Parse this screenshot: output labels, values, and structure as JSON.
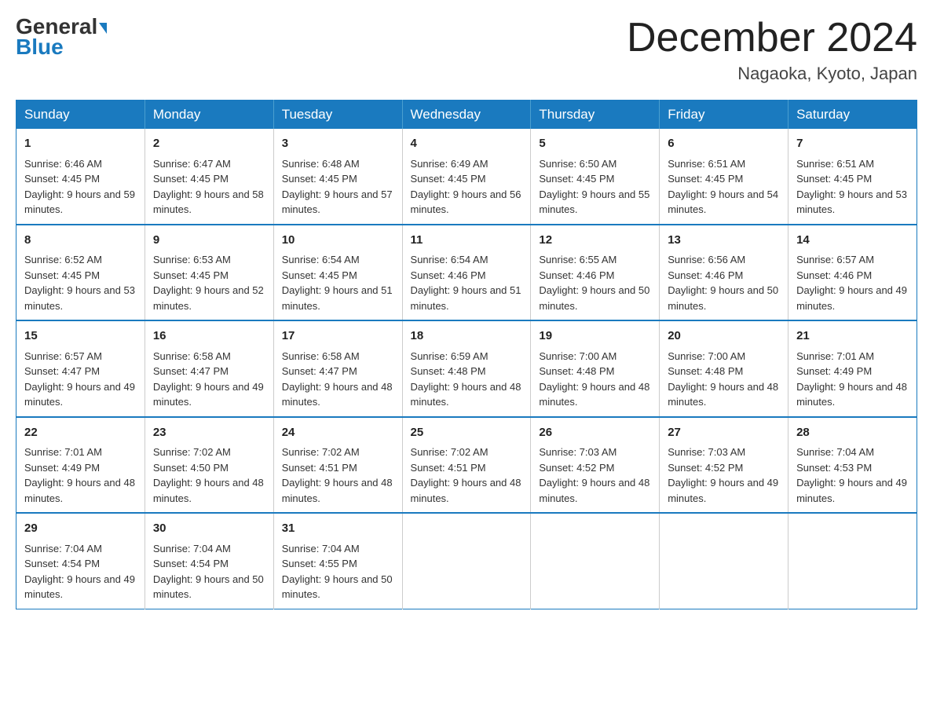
{
  "logo": {
    "part1": "General",
    "part2": "Blue"
  },
  "header": {
    "month": "December 2024",
    "location": "Nagaoka, Kyoto, Japan"
  },
  "days_of_week": [
    "Sunday",
    "Monday",
    "Tuesday",
    "Wednesday",
    "Thursday",
    "Friday",
    "Saturday"
  ],
  "weeks": [
    [
      {
        "day": "1",
        "sunrise": "6:46 AM",
        "sunset": "4:45 PM",
        "daylight": "9 hours and 59 minutes."
      },
      {
        "day": "2",
        "sunrise": "6:47 AM",
        "sunset": "4:45 PM",
        "daylight": "9 hours and 58 minutes."
      },
      {
        "day": "3",
        "sunrise": "6:48 AM",
        "sunset": "4:45 PM",
        "daylight": "9 hours and 57 minutes."
      },
      {
        "day": "4",
        "sunrise": "6:49 AM",
        "sunset": "4:45 PM",
        "daylight": "9 hours and 56 minutes."
      },
      {
        "day": "5",
        "sunrise": "6:50 AM",
        "sunset": "4:45 PM",
        "daylight": "9 hours and 55 minutes."
      },
      {
        "day": "6",
        "sunrise": "6:51 AM",
        "sunset": "4:45 PM",
        "daylight": "9 hours and 54 minutes."
      },
      {
        "day": "7",
        "sunrise": "6:51 AM",
        "sunset": "4:45 PM",
        "daylight": "9 hours and 53 minutes."
      }
    ],
    [
      {
        "day": "8",
        "sunrise": "6:52 AM",
        "sunset": "4:45 PM",
        "daylight": "9 hours and 53 minutes."
      },
      {
        "day": "9",
        "sunrise": "6:53 AM",
        "sunset": "4:45 PM",
        "daylight": "9 hours and 52 minutes."
      },
      {
        "day": "10",
        "sunrise": "6:54 AM",
        "sunset": "4:45 PM",
        "daylight": "9 hours and 51 minutes."
      },
      {
        "day": "11",
        "sunrise": "6:54 AM",
        "sunset": "4:46 PM",
        "daylight": "9 hours and 51 minutes."
      },
      {
        "day": "12",
        "sunrise": "6:55 AM",
        "sunset": "4:46 PM",
        "daylight": "9 hours and 50 minutes."
      },
      {
        "day": "13",
        "sunrise": "6:56 AM",
        "sunset": "4:46 PM",
        "daylight": "9 hours and 50 minutes."
      },
      {
        "day": "14",
        "sunrise": "6:57 AM",
        "sunset": "4:46 PM",
        "daylight": "9 hours and 49 minutes."
      }
    ],
    [
      {
        "day": "15",
        "sunrise": "6:57 AM",
        "sunset": "4:47 PM",
        "daylight": "9 hours and 49 minutes."
      },
      {
        "day": "16",
        "sunrise": "6:58 AM",
        "sunset": "4:47 PM",
        "daylight": "9 hours and 49 minutes."
      },
      {
        "day": "17",
        "sunrise": "6:58 AM",
        "sunset": "4:47 PM",
        "daylight": "9 hours and 48 minutes."
      },
      {
        "day": "18",
        "sunrise": "6:59 AM",
        "sunset": "4:48 PM",
        "daylight": "9 hours and 48 minutes."
      },
      {
        "day": "19",
        "sunrise": "7:00 AM",
        "sunset": "4:48 PM",
        "daylight": "9 hours and 48 minutes."
      },
      {
        "day": "20",
        "sunrise": "7:00 AM",
        "sunset": "4:48 PM",
        "daylight": "9 hours and 48 minutes."
      },
      {
        "day": "21",
        "sunrise": "7:01 AM",
        "sunset": "4:49 PM",
        "daylight": "9 hours and 48 minutes."
      }
    ],
    [
      {
        "day": "22",
        "sunrise": "7:01 AM",
        "sunset": "4:49 PM",
        "daylight": "9 hours and 48 minutes."
      },
      {
        "day": "23",
        "sunrise": "7:02 AM",
        "sunset": "4:50 PM",
        "daylight": "9 hours and 48 minutes."
      },
      {
        "day": "24",
        "sunrise": "7:02 AM",
        "sunset": "4:51 PM",
        "daylight": "9 hours and 48 minutes."
      },
      {
        "day": "25",
        "sunrise": "7:02 AM",
        "sunset": "4:51 PM",
        "daylight": "9 hours and 48 minutes."
      },
      {
        "day": "26",
        "sunrise": "7:03 AM",
        "sunset": "4:52 PM",
        "daylight": "9 hours and 48 minutes."
      },
      {
        "day": "27",
        "sunrise": "7:03 AM",
        "sunset": "4:52 PM",
        "daylight": "9 hours and 49 minutes."
      },
      {
        "day": "28",
        "sunrise": "7:04 AM",
        "sunset": "4:53 PM",
        "daylight": "9 hours and 49 minutes."
      }
    ],
    [
      {
        "day": "29",
        "sunrise": "7:04 AM",
        "sunset": "4:54 PM",
        "daylight": "9 hours and 49 minutes."
      },
      {
        "day": "30",
        "sunrise": "7:04 AM",
        "sunset": "4:54 PM",
        "daylight": "9 hours and 50 minutes."
      },
      {
        "day": "31",
        "sunrise": "7:04 AM",
        "sunset": "4:55 PM",
        "daylight": "9 hours and 50 minutes."
      },
      null,
      null,
      null,
      null
    ]
  ]
}
